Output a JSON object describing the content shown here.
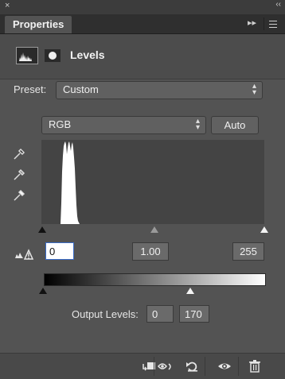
{
  "window": {
    "close_glyph": "×",
    "collapse_glyph": "‹‹"
  },
  "panel": {
    "tab_label": "Properties",
    "expand_glyph": "▸▸"
  },
  "header": {
    "title": "Levels",
    "adjustment_icon": "levels-histogram-icon",
    "mask_icon": "layer-mask-icon"
  },
  "preset": {
    "label": "Preset:",
    "value": "Custom"
  },
  "channel": {
    "value": "RGB"
  },
  "auto_button": {
    "label": "Auto"
  },
  "eyedroppers": [
    "black-point-eyedropper-icon",
    "gray-point-eyedropper-icon",
    "white-point-eyedropper-icon"
  ],
  "input_levels": {
    "black": "0",
    "gamma": "1.00",
    "white": "255"
  },
  "output_levels": {
    "label": "Output Levels:",
    "black": "0",
    "white": "170"
  },
  "colors": {
    "panel_bg": "#535353",
    "histogram_bg": "#444444",
    "histogram_fill": "#ffffff",
    "input_focus": "#3a6cc8"
  },
  "footer_icons": [
    "clip-to-layer-icon",
    "view-previous-state-icon",
    "reset-icon",
    "toggle-visibility-icon",
    "delete-icon"
  ]
}
